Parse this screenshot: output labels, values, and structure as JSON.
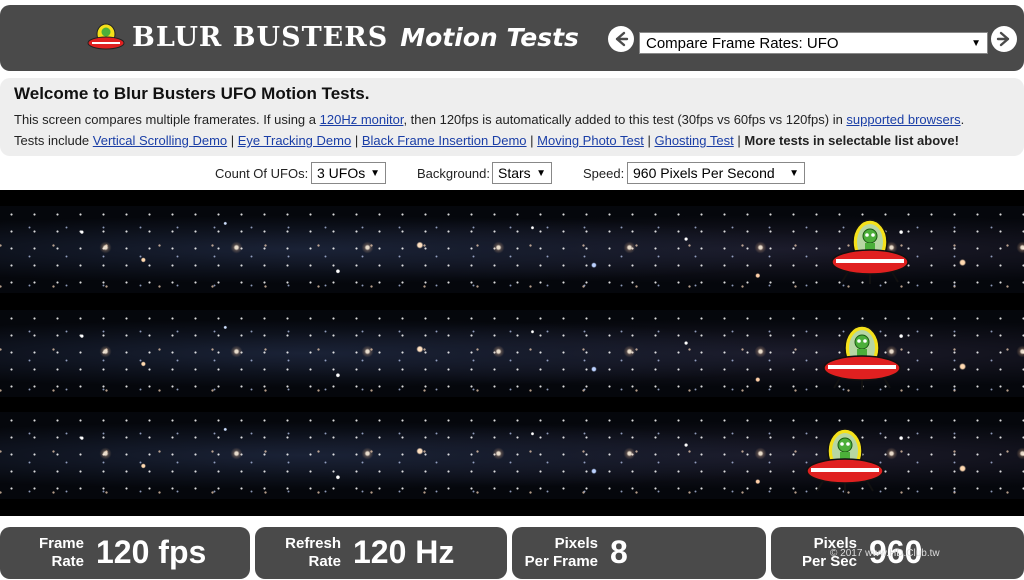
{
  "header": {
    "logo_main": "BLUR BUSTERS",
    "logo_sub": "Motion Tests",
    "test_select_value": "Compare Frame Rates: UFO"
  },
  "info": {
    "title": "Welcome to Blur Busters UFO Motion Tests.",
    "line1_a": "This screen compares multiple framerates. If using a ",
    "line1_link1": "120Hz monitor",
    "line1_b": ", then 120fps is automatically added to this test (30fps vs 60fps vs 120fps) in ",
    "line1_link2": "supported browsers",
    "line1_c": ".",
    "line2_prefix": "Tests include ",
    "links": [
      "Vertical Scrolling Demo",
      "Eye Tracking Demo",
      "Black Frame Insertion Demo",
      "Moving Photo Test",
      "Ghosting Test"
    ],
    "separator": " | ",
    "line2_suffix": "More tests in selectable list above!"
  },
  "options": {
    "count_label": "Count Of UFOs:",
    "count_value": "3 UFOs",
    "background_label": "Background:",
    "background_value": "Stars",
    "speed_label": "Speed:",
    "speed_value": "960 Pixels Per Second"
  },
  "stats": [
    {
      "label_line1": "Frame",
      "label_line2": "Rate",
      "value": "120 fps"
    },
    {
      "label_line1": "Refresh",
      "label_line2": "Rate",
      "value": "120 Hz"
    },
    {
      "label_line1": "Pixels",
      "label_line2": "Per Frame",
      "value": "8"
    },
    {
      "label_line1": "Pixels",
      "label_line2": "Per Sec",
      "value": "960"
    }
  ],
  "watermark": "© 2017 www.HD.Club.tw",
  "colors": {
    "header_bg": "#4a4a4a",
    "info_bg": "#eeeeee",
    "link": "#1a3ea6",
    "ufo_saucer": "#e02020",
    "ufo_dome": "#f5e11a",
    "alien": "#4caf3a"
  }
}
